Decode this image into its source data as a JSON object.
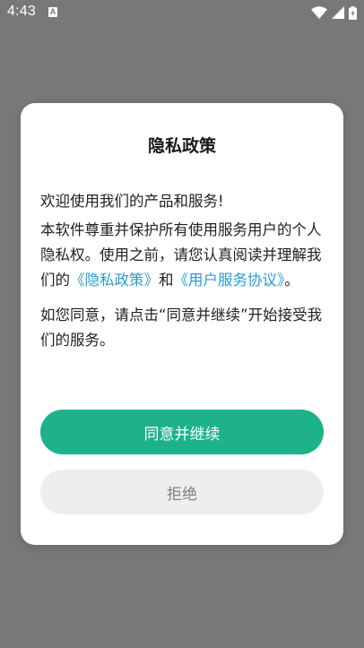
{
  "status_bar": {
    "time": "4:43",
    "notification_glyph": "A",
    "icons": [
      "wifi-icon",
      "signal-icon",
      "battery-icon"
    ]
  },
  "colors": {
    "overlay": "#787878",
    "accent": "#1db28a",
    "link": "#2a9ad8"
  },
  "dialog": {
    "title": "隐私政策",
    "greeting": "欢迎使用我们的产品和服务!",
    "body_intro": "本软件尊重并保护所有使用服务用户的个人隐私权。使用之前，请您认真阅读并理解我们的",
    "privacy_link": "《隐私政策》",
    "and_text": "和",
    "agreement_link": "《用户服务协议》",
    "period": "。",
    "consent_text": "如您同意，请点击“同意并继续”开始接受我们的服务。",
    "agree_button": "同意并继续",
    "reject_button": "拒绝"
  }
}
